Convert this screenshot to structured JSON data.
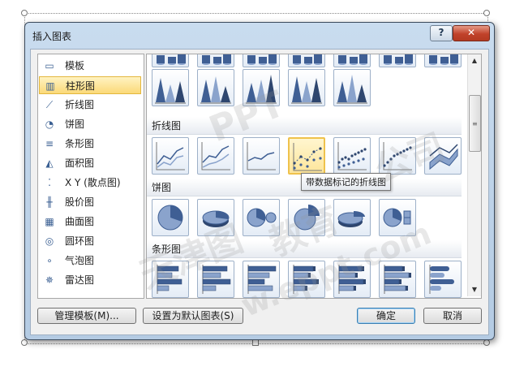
{
  "dialog": {
    "title": "插入图表",
    "help_label": "?",
    "close_label": "✕"
  },
  "categories": [
    {
      "label": "模板",
      "icon": "folder-icon",
      "glyph": "▭"
    },
    {
      "label": "柱形图",
      "icon": "column-chart-icon",
      "glyph": "▥",
      "selected": true
    },
    {
      "label": "折线图",
      "icon": "line-chart-icon",
      "glyph": "⟋"
    },
    {
      "label": "饼图",
      "icon": "pie-chart-icon",
      "glyph": "◔"
    },
    {
      "label": "条形图",
      "icon": "bar-chart-icon",
      "glyph": "≡"
    },
    {
      "label": "面积图",
      "icon": "area-chart-icon",
      "glyph": "◭"
    },
    {
      "label": "X Y (散点图)",
      "icon": "scatter-chart-icon",
      "glyph": "⁚"
    },
    {
      "label": "股价图",
      "icon": "stock-chart-icon",
      "glyph": "╫"
    },
    {
      "label": "曲面图",
      "icon": "surface-chart-icon",
      "glyph": "▦"
    },
    {
      "label": "圆环图",
      "icon": "doughnut-chart-icon",
      "glyph": "◎"
    },
    {
      "label": "气泡图",
      "icon": "bubble-chart-icon",
      "glyph": "∘"
    },
    {
      "label": "雷达图",
      "icon": "radar-chart-icon",
      "glyph": "✵"
    }
  ],
  "sections": {
    "line": "折线图",
    "pie": "饼图",
    "bar": "条形图"
  },
  "tooltip": "带数据标记的折线图",
  "buttons": {
    "manage_templates": "管理模板(M)...",
    "set_default": "设置为默认图表(S)",
    "ok": "确定",
    "cancel": "取消"
  },
  "watermark": {
    "line1": "PPT",
    "line2": "天津图",
    "line3": "教育",
    "line4": "公司",
    "line5": "w.eppt.com"
  },
  "colors": {
    "accent": "#3f5f94",
    "selection": "#fbd978",
    "tile_border": "#9db0c8"
  }
}
